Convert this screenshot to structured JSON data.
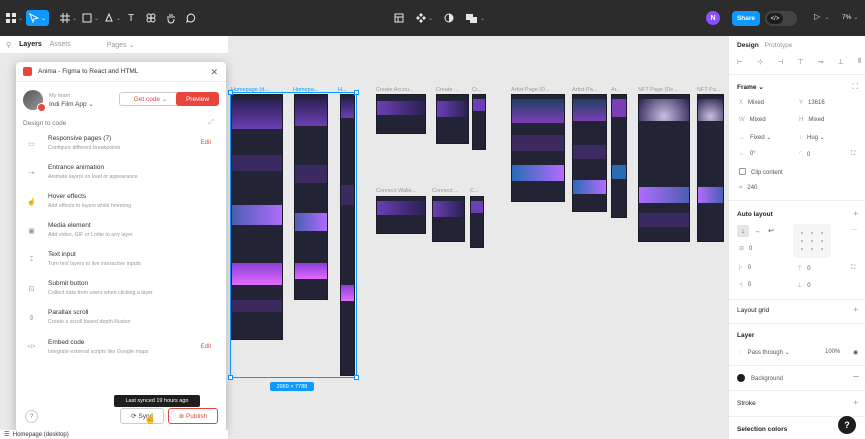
{
  "toolbar": {
    "text_tool": "T",
    "avatar_initial": "N",
    "share_label": "Share",
    "code_label": "</>",
    "play_label": "▷",
    "zoom": "7%"
  },
  "left_panel": {
    "tabs": [
      "Layers",
      "Assets"
    ],
    "pages_label": "Pages",
    "footer_layer": "Homepage (desktop)"
  },
  "plugin": {
    "title": "Anima - Figma to React and HTML",
    "team_label": "My team",
    "app_name": "Indi Film App",
    "get_code_label": "Get code",
    "preview_label": "Preview",
    "section_title": "Design to code",
    "features": [
      {
        "icon": "▭",
        "title": "Responsive pages (7)",
        "desc": "Configure different breakpoints",
        "edit": "Edit"
      },
      {
        "icon": "⇢",
        "title": "Entrance animation",
        "desc": "Animate layers on load or appearance",
        "edit": ""
      },
      {
        "icon": "☝",
        "title": "Hover effects",
        "desc": "Add effects to layers while hovering",
        "edit": ""
      },
      {
        "icon": "▣",
        "title": "Media element",
        "desc": "Add video, GIF or Lottie to any layer",
        "edit": ""
      },
      {
        "icon": "⌶",
        "title": "Text input",
        "desc": "Turn text layers to live interactive inputs",
        "edit": ""
      },
      {
        "icon": "⊡",
        "title": "Submit button",
        "desc": "Collect data from users when clicking a layer",
        "edit": ""
      },
      {
        "icon": "⇕",
        "title": "Parallax scroll",
        "desc": "Create a scroll based depth illusion",
        "edit": ""
      },
      {
        "icon": "</>",
        "title": "Embed code",
        "desc": "Integrate external scripts like Google maps",
        "edit": "Edit"
      }
    ],
    "help_label": "?",
    "sync_label": "Sync",
    "publish_label": "Publish",
    "tooltip": "Last synced 19 hours ago"
  },
  "canvas": {
    "frames": [
      {
        "label": "Homepage (d..."
      },
      {
        "label": "Homepa..."
      },
      {
        "label": "H..."
      },
      {
        "label": "Create Accou..."
      },
      {
        "label": "Create ..."
      },
      {
        "label": "Cr..."
      },
      {
        "label": "Artist Page (D..."
      },
      {
        "label": "Artist Pa..."
      },
      {
        "label": "Ar..."
      },
      {
        "label": "NFT Page (De..."
      },
      {
        "label": "NFT Pa..."
      },
      {
        "label": "Connect Walle..."
      },
      {
        "label": "Connect ..."
      },
      {
        "label": "C..."
      }
    ],
    "selection_size": "2969 × 7788"
  },
  "right_panel": {
    "tabs": [
      "Design",
      "Prototype"
    ],
    "frame_label": "Frame",
    "x_label": "X",
    "x_value": "Mixed",
    "y_label": "Y",
    "y_value": "13616",
    "w_label": "W",
    "w_value": "Mixed",
    "h_label": "H",
    "h_value": "Mixed",
    "width_mode": "Fixed",
    "height_mode": "Hug",
    "rotation": "0°",
    "radius": "0",
    "clip_content": "Clip content",
    "size_value": "240",
    "auto_layout": "Auto layout",
    "gap": "0",
    "pad_left": "0",
    "pad_top": "0",
    "pad_right": "0",
    "pad_bottom": "0",
    "layout_grid": "Layout grid",
    "layer": "Layer",
    "pass_through": "Pass through",
    "opacity": "100%",
    "fill_name": "Background",
    "stroke": "Stroke",
    "selection_colors": "Selection colors",
    "help": "?"
  }
}
